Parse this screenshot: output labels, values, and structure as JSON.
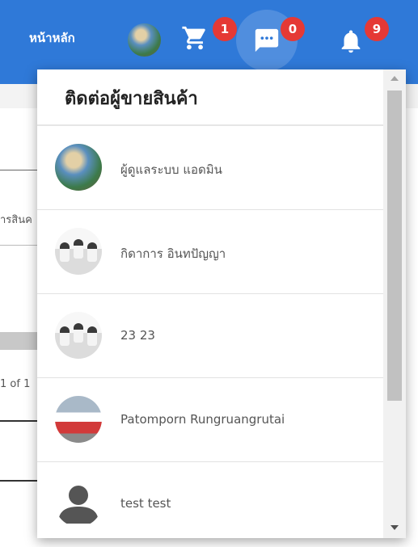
{
  "header": {
    "home_label": "หน้าหลัก",
    "badges": {
      "cart": "1",
      "messages": "0",
      "notifications": "9"
    }
  },
  "background": {
    "text_fragment_1": "ารสินค",
    "text_fragment_2": "1 of 1"
  },
  "panel": {
    "title": "ติดต่อผู้ขายสินค้า",
    "contacts": [
      {
        "name": "ผู้ดูแลระบบ แอดมิน",
        "avatar": "photo-avatar"
      },
      {
        "name": "กิดาการ อินทปัญญา",
        "avatar": "group-photo-avatar"
      },
      {
        "name": "23 23",
        "avatar": "group-photo-avatar"
      },
      {
        "name": "Patomporn Rungruangrutai",
        "avatar": "crowd-photo-avatar"
      },
      {
        "name": "test test",
        "avatar": "default-user-icon"
      }
    ]
  },
  "colors": {
    "appbar": "#2f79d8",
    "badge": "#e53935"
  }
}
